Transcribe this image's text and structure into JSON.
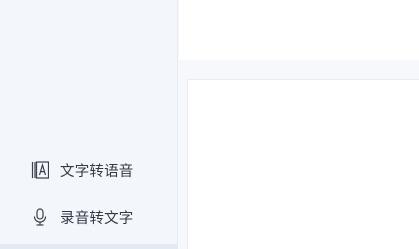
{
  "sidebar": {
    "items": [
      {
        "label": "文字转语音",
        "icon": "text-to-speech-icon"
      },
      {
        "label": "录音转文字",
        "icon": "microphone-icon"
      }
    ]
  },
  "colors": {
    "sidebar_bg": "#f3f6fb",
    "content_bg": "#ffffff",
    "text": "#333a44",
    "icon": "#3a404a"
  }
}
